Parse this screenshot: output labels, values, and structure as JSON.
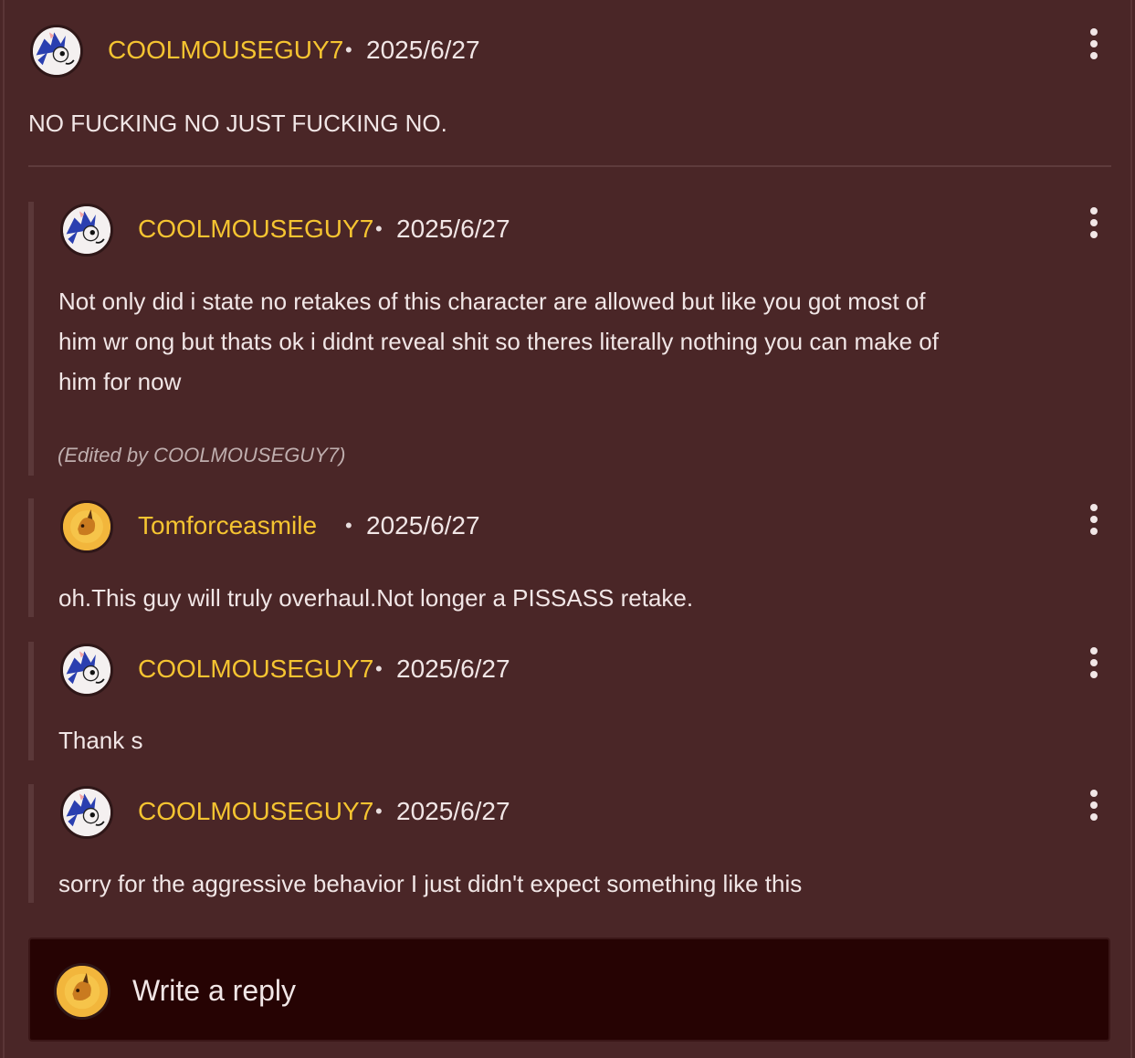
{
  "comments": [
    {
      "author": "COOLMOUSEGUY7",
      "separator": "•",
      "date": "2025/6/27",
      "text": "NO FUCKING NO JUST FUCKING NO.",
      "avatar_icon": "blue-hedgehog-avatar"
    },
    {
      "author": "COOLMOUSEGUY7",
      "separator": "•",
      "date": "2025/6/27",
      "text_lines": [
        "Not only did i state no retakes of this character are allowed but like you got most of",
        "him wr ong but thats ok i didnt reveal shit so theres literally nothing you can make of",
        "him for now"
      ],
      "edited": "(Edited by COOLMOUSEGUY7)",
      "avatar_icon": "blue-hedgehog-avatar"
    },
    {
      "author": "Tomforceasmile",
      "separator": "•",
      "date": "2025/6/27",
      "text": "oh.This guy will truly overhaul.Not longer a PISSASS retake.",
      "avatar_icon": "orange-creature-avatar"
    },
    {
      "author": "COOLMOUSEGUY7",
      "separator": "•",
      "date": "2025/6/27",
      "text": "Thank s",
      "avatar_icon": "blue-hedgehog-avatar"
    },
    {
      "author": "COOLMOUSEGUY7",
      "separator": "•",
      "date": "2025/6/27",
      "text": "sorry for the aggressive behavior I just didn't expect something like this",
      "avatar_icon": "blue-hedgehog-avatar"
    }
  ],
  "reply": {
    "placeholder": "Write a reply",
    "avatar_icon": "orange-creature-avatar"
  },
  "colors": {
    "background": "#4a2627",
    "author": "#f5c431",
    "text": "#f1e6e6",
    "reply_box": "#260303"
  }
}
